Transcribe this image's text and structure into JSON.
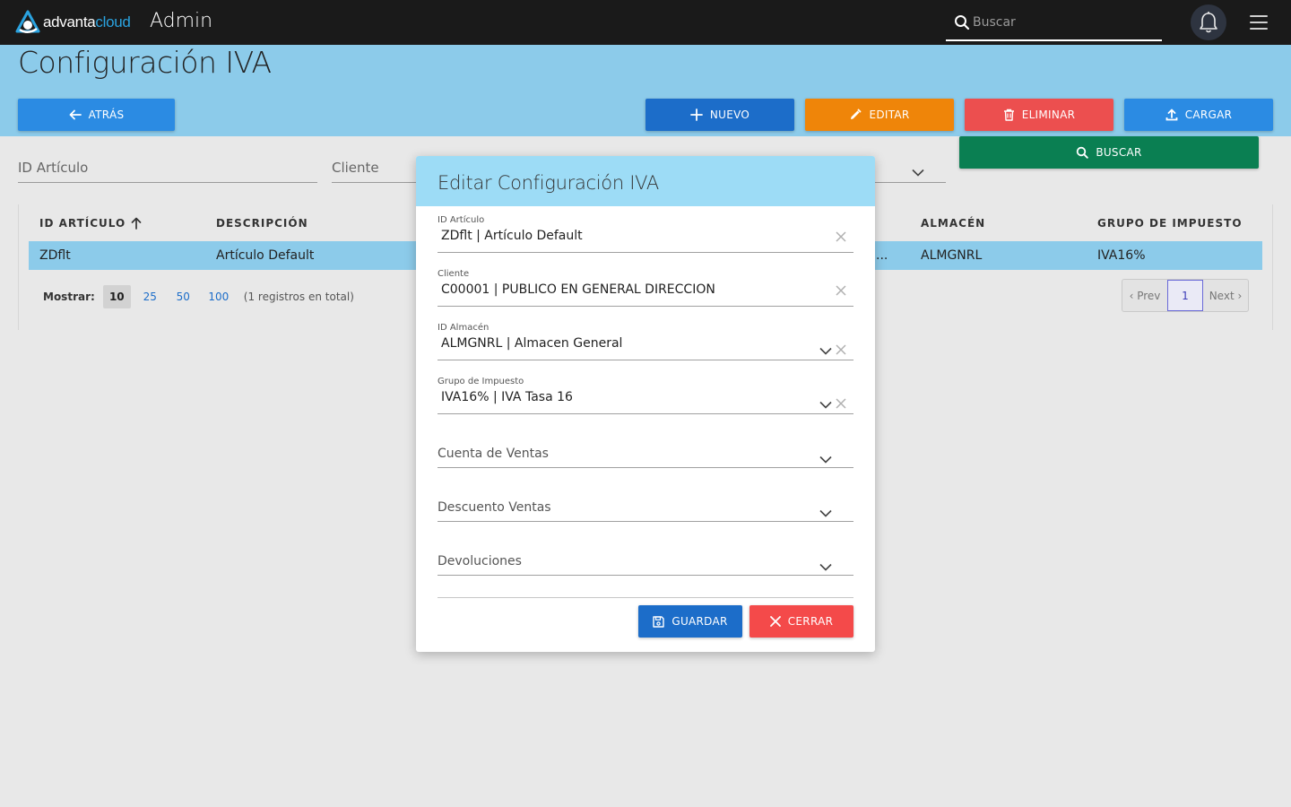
{
  "topbar": {
    "logo_left": "advanta",
    "logo_right": "cloud",
    "app_name": "Admin",
    "search_placeholder": "Buscar"
  },
  "page": {
    "title": "Configuración IVA"
  },
  "toolbar": {
    "back": "ATRÁS",
    "new": "NUEVO",
    "edit": "EDITAR",
    "delete": "ELIMINAR",
    "upload": "CARGAR",
    "search": "BUSCAR"
  },
  "filters": {
    "article_id": "ID Artículo",
    "client": "Cliente"
  },
  "table": {
    "columns": [
      "ID ARTÍCULO",
      "DESCRIPCIÓN",
      "ALMACÉN",
      "GRUPO DE IMPUESTO"
    ],
    "rows": [
      {
        "id": "ZDflt",
        "description": "Artículo Default",
        "truncated": "...",
        "warehouse": "ALMGNRL",
        "tax_group": "IVA16%"
      }
    ]
  },
  "pagination": {
    "show_label": "Mostrar:",
    "sizes": [
      "10",
      "25",
      "50",
      "100"
    ],
    "total_text": "(1 registros en total)",
    "prev": "‹ Prev",
    "current": "1",
    "next": "Next ›"
  },
  "modal": {
    "title": "Editar Configuración IVA",
    "fields": [
      {
        "label": "ID Artículo",
        "value": "ZDflt | Artículo Default"
      },
      {
        "label": "Cliente",
        "value": "C00001 | PUBLICO EN GENERAL DIRECCION"
      },
      {
        "label": "ID Almacén",
        "value": "ALMGNRL | Almacen General"
      },
      {
        "label": "Grupo de Impuesto",
        "value": "IVA16% | IVA Tasa 16"
      },
      {
        "label": "Cuenta de Ventas",
        "value": ""
      },
      {
        "label": "Descuento Ventas",
        "value": ""
      },
      {
        "label": "Devoluciones",
        "value": ""
      }
    ],
    "save": "GUARDAR",
    "close": "CERRAR"
  },
  "colors": {
    "topbar": "#1a1a1a",
    "band": "#8ccbea",
    "primary": "#1c6dc9",
    "warning": "#ef8509",
    "danger": "#ec4f4f",
    "success": "#0a7f52"
  }
}
